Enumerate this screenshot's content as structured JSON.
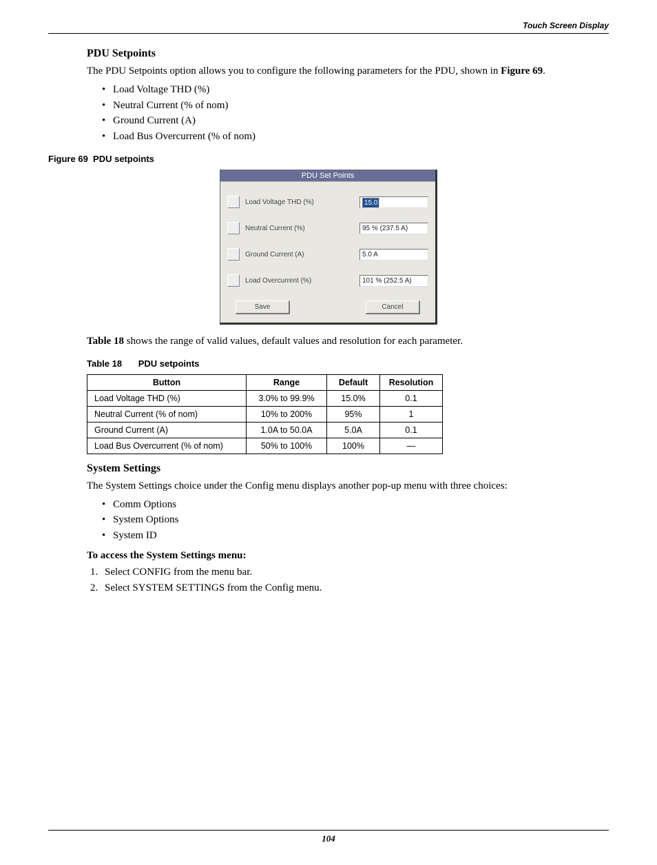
{
  "header": {
    "section": "Touch Screen Display"
  },
  "pdu": {
    "heading": "PDU Setpoints",
    "intro_a": "The PDU Setpoints option allows you to configure the following parameters for the PDU, shown in ",
    "intro_ref": "Figure 69",
    "intro_b": ".",
    "bullets": [
      "Load Voltage THD (%)",
      "Neutral Current (% of nom)",
      "Ground Current (A)",
      "Load Bus Overcurrent (% of nom)"
    ]
  },
  "figure": {
    "number": "Figure 69",
    "title": "PDU setpoints",
    "dialog": {
      "title": "PDU Set Points",
      "rows": [
        {
          "label": "Load Voltage THD (%)",
          "value": "15.0",
          "selected": true
        },
        {
          "label": "Neutral Current (%)",
          "value": "95 % (237.5 A)"
        },
        {
          "label": "Ground Current (A)",
          "value": "5.0 A"
        },
        {
          "label": "Load Overcurrent (%)",
          "value": "101 % (252.5 A)"
        }
      ],
      "save": "Save",
      "cancel": "Cancel"
    }
  },
  "table_intro_a": "Table 18",
  "table_intro_b": " shows the range of valid values, default values and resolution for each parameter.",
  "table18": {
    "number": "Table 18",
    "title": "PDU setpoints",
    "headers": [
      "Button",
      "Range",
      "Default",
      "Resolution"
    ],
    "rows": [
      [
        "Load Voltage THD (%)",
        "3.0% to 99.9%",
        "15.0%",
        "0.1"
      ],
      [
        "Neutral Current (% of nom)",
        "10% to 200%",
        "95%",
        "1"
      ],
      [
        "Ground Current (A)",
        "1.0A to 50.0A",
        "5.0A",
        "0.1"
      ],
      [
        "Load Bus Overcurrent (% of nom)",
        "50% to 100%",
        "100%",
        "—"
      ]
    ]
  },
  "system": {
    "heading": "System Settings",
    "intro": "The System Settings choice under the Config menu displays another pop-up menu with three choices:",
    "bullets": [
      "Comm Options",
      "System Options",
      "System ID"
    ],
    "access_heading": "To access the System Settings menu:",
    "steps": [
      "Select CONFIG from the menu bar.",
      "Select SYSTEM SETTINGS from the Config menu."
    ]
  },
  "page_number": "104"
}
